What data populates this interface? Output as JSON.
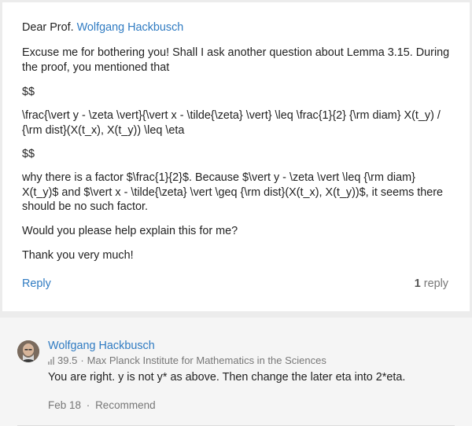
{
  "question": {
    "greeting_prefix": "Dear Prof.",
    "greeting_name": "Wolfgang Hackbusch",
    "paragraphs": [
      "Excuse me for bothering you! Shall I ask another question about Lemma 3.15. During the proof, you mentioned that",
      "$$",
      "\\frac{\\vert y - \\zeta \\vert}{\\vert x - \\tilde{\\zeta} \\vert} \\leq \\frac{1}{2} {\\rm diam} X(t_y) / {\\rm dist}(X(t_x), X(t_y)) \\leq \\eta",
      "$$",
      "why there is a factor $\\frac{1}{2}$. Because $\\vert y - \\zeta \\vert \\leq {\\rm diam} X(t_y)$ and $\\vert x - \\tilde{\\zeta} \\vert \\geq {\\rm dist}(X(t_x), X(t_y))$, it seems there should be no such factor.",
      "Would you please help explain this for me?",
      "Thank you very much!"
    ],
    "reply_label": "Reply",
    "reply_count": "1",
    "reply_count_suffix": "reply"
  },
  "answer": {
    "author": "Wolfgang Hackbusch",
    "score": "39.5",
    "separator": "·",
    "institution": "Max Planck Institute for Mathematics in the Sciences",
    "text": "You are right. y is not y* as above. Then change the later eta into 2*eta.",
    "date": "Feb 18",
    "recommend_label": "Recommend"
  },
  "colors": {
    "link": "#2f7bc2",
    "muted": "#777777",
    "background": "#ececec"
  }
}
